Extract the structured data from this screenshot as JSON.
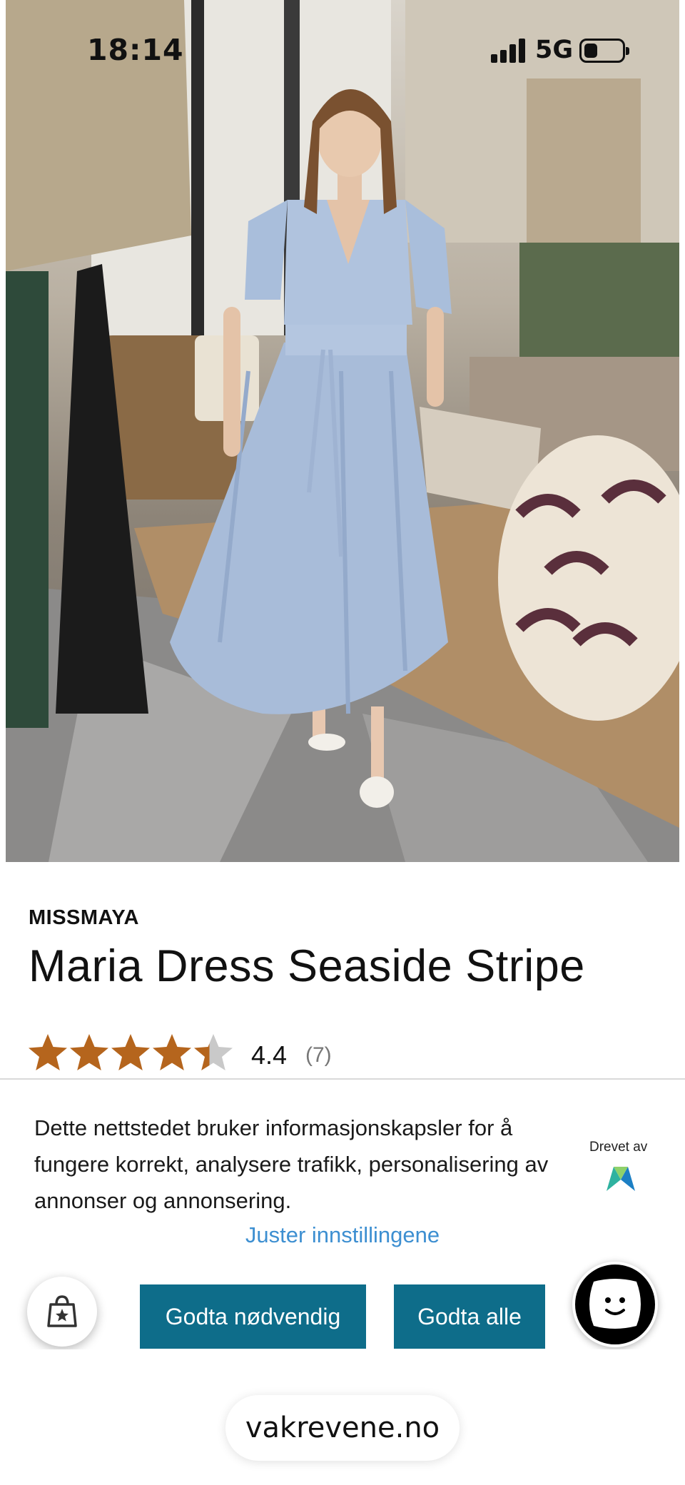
{
  "status_bar": {
    "time": "18:14",
    "network": "5G"
  },
  "product": {
    "brand": "MISSMAYA",
    "title": "Maria Dress Seaside Stripe",
    "rating": {
      "value": "4.4",
      "count": "(7)",
      "stars": 4.4,
      "max": 5
    }
  },
  "cookie_banner": {
    "text": "Dette nettstedet bruker informasjonskapsler for å fungere korrekt, analysere trafikk, personalisering av annonser og annonsering.",
    "powered_by": "Drevet av",
    "adjust_link": "Juster innstillingene",
    "accept_necessary": "Godta nødvendig",
    "accept_all": "Godta alle"
  },
  "browser": {
    "url": "vakrevene.no"
  },
  "colors": {
    "star": "#b5651d",
    "button": "#0e6d8a",
    "link": "#3d8fd1"
  },
  "icons": [
    "shopping-bag-icon",
    "chat-face-icon",
    "powered-by-logo-icon",
    "signal-icon",
    "battery-icon"
  ]
}
